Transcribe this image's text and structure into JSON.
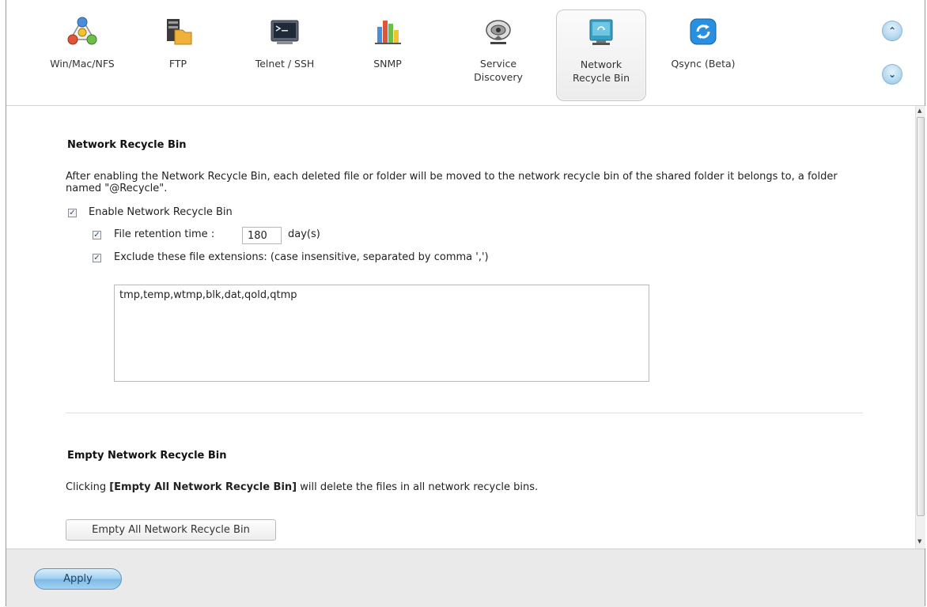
{
  "tabs": [
    {
      "label": "Win/Mac/NFS",
      "icon": "network-share-icon"
    },
    {
      "label": "FTP",
      "icon": "ftp-folder-icon"
    },
    {
      "label": "Telnet / SSH",
      "icon": "terminal-icon"
    },
    {
      "label": "SNMP",
      "icon": "bar-chart-icon"
    },
    {
      "label": "Service\nDiscovery",
      "icon": "satellite-dish-icon"
    },
    {
      "label": "Network\nRecycle Bin",
      "icon": "recycle-bin-icon",
      "active": true
    },
    {
      "label": "Qsync (Beta)",
      "icon": "sync-icon"
    }
  ],
  "nav": {
    "up_icon": "chevron-up-icon",
    "down_icon": "chevron-down-icon"
  },
  "recycle": {
    "title": "Network Recycle Bin",
    "description": "After enabling the Network Recycle Bin, each deleted file or folder will be moved to the network recycle bin of the shared folder it belongs to, a folder named \"@Recycle\".",
    "enable_label": "Enable Network Recycle Bin",
    "enable_checked": true,
    "retention_label": "File retention time :",
    "retention_checked": true,
    "retention_value": "180",
    "retention_unit": "day(s)",
    "exclude_label": "Exclude these file extensions: (case insensitive, separated by comma ',')",
    "exclude_checked": true,
    "extensions": "tmp,temp,wtmp,blk,dat,qold,qtmp"
  },
  "empty": {
    "title": "Empty Network Recycle Bin",
    "desc_prefix": "Clicking ",
    "desc_bold": "[Empty All Network Recycle Bin]",
    "desc_suffix": " will delete the files in all network recycle bins.",
    "button_label": "Empty All Network Recycle Bin"
  },
  "footer": {
    "apply_label": "Apply"
  },
  "colors": {
    "accent": "#8fc3e4",
    "apply_button": "#a6d2f1"
  }
}
